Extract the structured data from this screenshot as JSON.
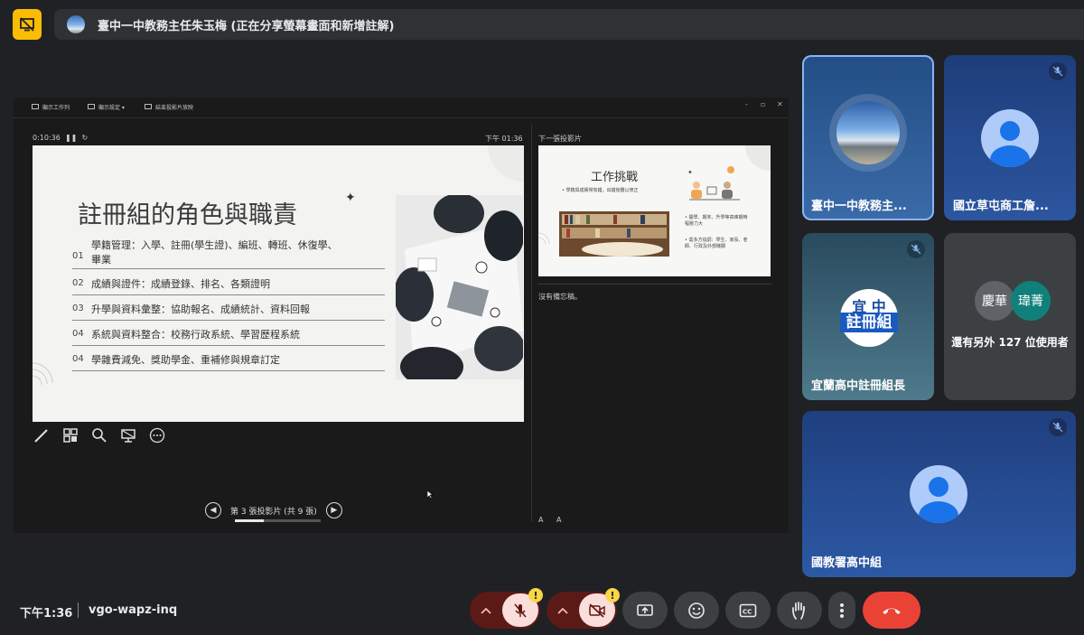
{
  "meeting": {
    "presenter_banner": "臺中一中教務主任朱玉梅 (正在分享螢幕畫面和新增註解)",
    "time": "下午1:36",
    "code": "vgo-wapz-inq"
  },
  "presenter_view": {
    "toolbar": [
      "顯示工作列",
      "顯示設定 ▾",
      "結束投影片放映"
    ],
    "window_controls": [
      "-",
      "▫",
      "✕"
    ],
    "timer": "0:10:36",
    "clock": "下午 01:36",
    "next_slide_label": "下一張投影片",
    "notes_text": "沒有備忘稿。",
    "font_buttons": [
      "A",
      "A"
    ],
    "slide_counter": "第 3 張投影片 (共 9 張)",
    "slide_progress": 0.333
  },
  "current_slide": {
    "title": "註冊組的角色與職責",
    "rows": [
      {
        "num": "01",
        "text_line1": "學籍管理：入學、註冊(學生證)、編班、轉班、休復學、",
        "text_line2": "畢業"
      },
      {
        "num": "02",
        "text_line1": "成績與證件：成績登錄、排名、各類證明",
        "text_line2": ""
      },
      {
        "num": "03",
        "text_line1": "升學與資料彙整：協助報名、成績統計、資料回報",
        "text_line2": ""
      },
      {
        "num": "04",
        "text_line1": "系統與資料整合：校務行政系統、學習歷程系統",
        "text_line2": ""
      },
      {
        "num": "04",
        "text_line1": "學雜費減免、獎助學金、重補修與規章訂定",
        "text_line2": ""
      }
    ]
  },
  "next_slide": {
    "title": "工作挑戰",
    "subtitle": "• 學籍與成績常有錯，出錯後難以修正",
    "bullets": [
      "• 開學、期末、升學等高峰期時程壓力大",
      "• 需多方協調：學生、家長、老師、行政及外部機關"
    ]
  },
  "participants": [
    {
      "name": "臺中一中教務主...",
      "muted": false
    },
    {
      "name": "國立草屯商工詹...",
      "muted": true
    },
    {
      "name": "宜蘭高中註冊組長",
      "muted": true,
      "logo_line1": "宜 中",
      "logo_line2": "註冊組"
    },
    {
      "overflow_text": "還有另外 127 位使用者",
      "avatars": [
        "慶華",
        "瑋菁"
      ]
    },
    {
      "name": "國教署高中組",
      "muted": true
    }
  ],
  "colors": {
    "background": "#202124",
    "present_badge": "#fbbc04",
    "danger": "#ea4335",
    "control_dark": "#3c4043",
    "control_off": "#5c1a16",
    "warning": "#f9d548"
  },
  "controls": {
    "warning_badge": "!",
    "icons": [
      "chevron-up-icon",
      "mic-off-icon",
      "camera-off-icon",
      "present-icon",
      "emoji-icon",
      "captions-icon",
      "raise-hand-icon",
      "more-icon",
      "hang-up-icon"
    ]
  }
}
